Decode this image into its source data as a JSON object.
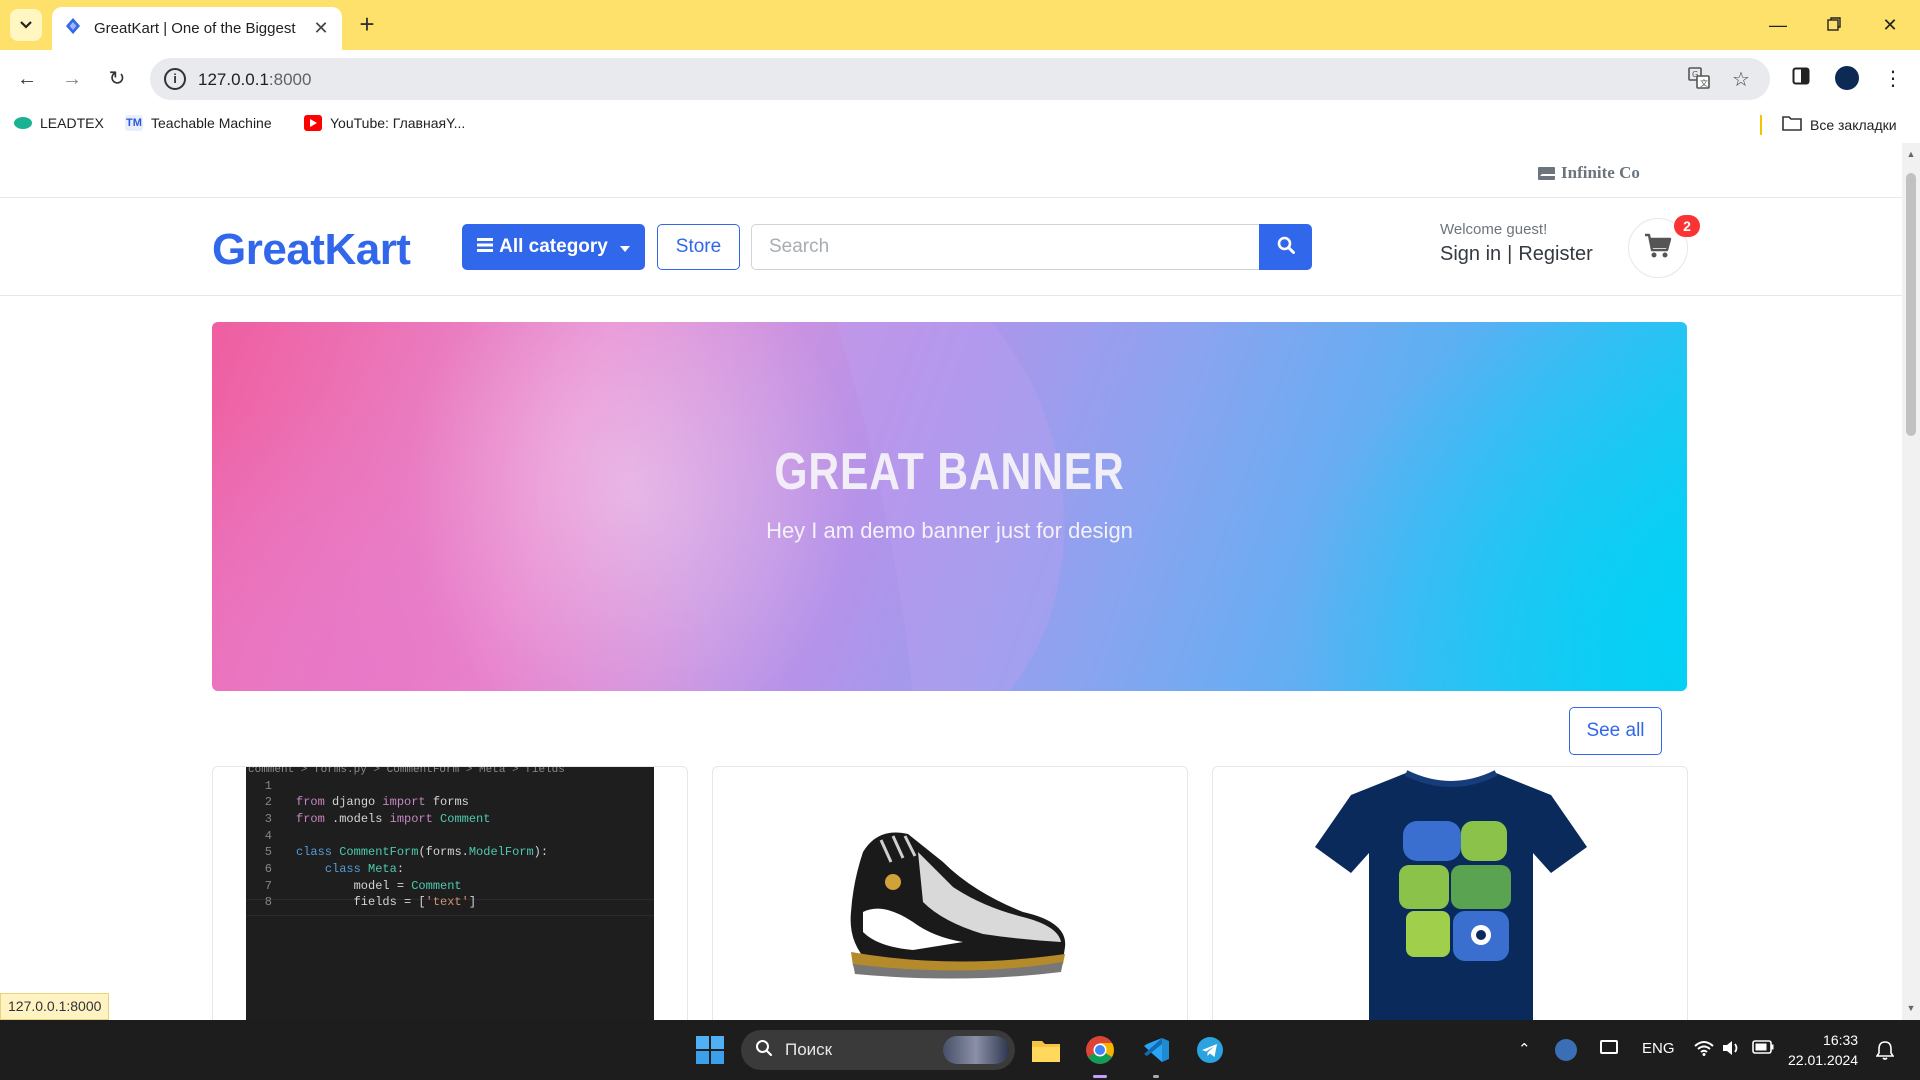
{
  "browser": {
    "tab_title": "GreatKart | One of the Biggest O",
    "url_host": "127.0.0.1",
    "url_rest": ":8000",
    "bookmarks": [
      {
        "label": "LEADTEX",
        "color": "#19b394"
      },
      {
        "label": "Teachable Machine",
        "color": "#2b57d9"
      },
      {
        "label": "YouTube: ГлавнаяY...",
        "color": "#ff0000"
      }
    ],
    "all_bookmarks_label": "Все закладки"
  },
  "site": {
    "topline_label": "Infinite Co",
    "logo": "GreatKart",
    "category_button": "All category",
    "store_button": "Store",
    "search_placeholder": "Search",
    "welcome": "Welcome guest!",
    "sign_in": "Sign in",
    "separator": "|",
    "register": "Register",
    "cart_count": "2",
    "brand_color": "#3167eb",
    "banner_title": "GREAT BANNER",
    "banner_subtitle": "Hey I am demo banner just for design",
    "see_all": "See all"
  },
  "products": [
    {
      "image": "code-screenshot"
    },
    {
      "image": "sneaker"
    },
    {
      "image": "t-shirt"
    }
  ],
  "code_image": {
    "breadcrumb": "comment > forms.py > CommentForm > Meta > fields",
    "lines": [
      {
        "n": "1",
        "text": ""
      },
      {
        "n": "2",
        "text": "from django import forms"
      },
      {
        "n": "3",
        "text": "from .models import Comment"
      },
      {
        "n": "4",
        "text": ""
      },
      {
        "n": "5",
        "text": "class CommentForm(forms.ModelForm):"
      },
      {
        "n": "6",
        "text": "    class Meta:"
      },
      {
        "n": "7",
        "text": "        model = Comment"
      },
      {
        "n": "8",
        "text": "        fields = ['text']"
      }
    ]
  },
  "status_url": "127.0.0.1:8000",
  "taskbar": {
    "search_label": "Поиск",
    "lang": "ENG",
    "time": "16:33",
    "date": "22.01.2024"
  }
}
